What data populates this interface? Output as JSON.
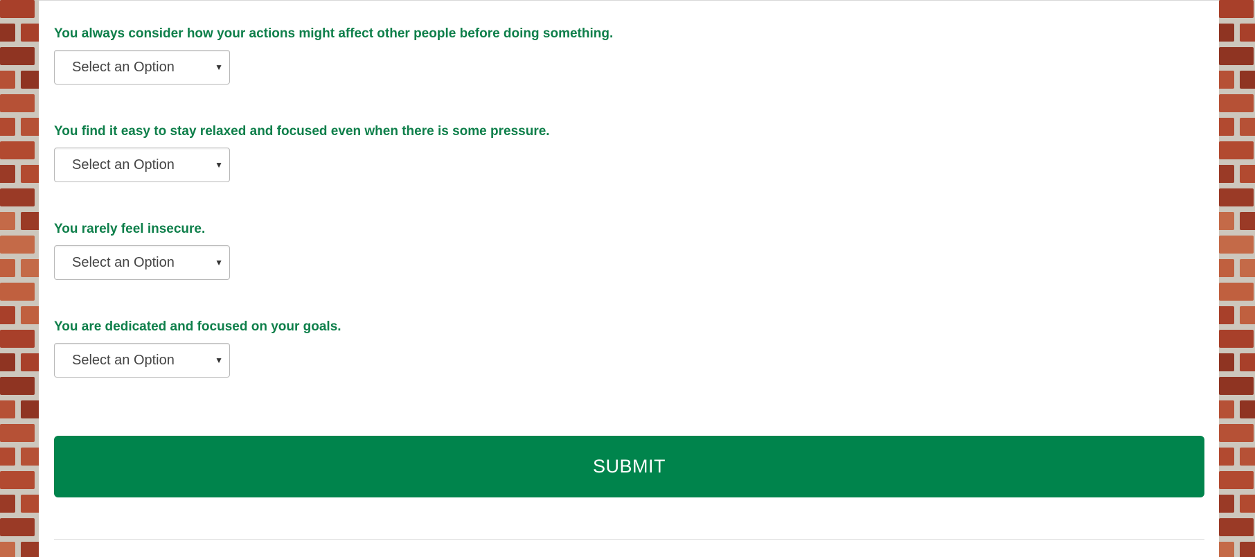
{
  "questions": [
    {
      "label": "You always consider how your actions might affect other people before doing something.",
      "select_value": "Select an Option"
    },
    {
      "label": "You find it easy to stay relaxed and focused even when there is some pressure.",
      "select_value": "Select an Option"
    },
    {
      "label": "You rarely feel insecure.",
      "select_value": "Select an Option"
    },
    {
      "label": "You are dedicated and focused on your goals.",
      "select_value": "Select an Option"
    }
  ],
  "select_icon": "chevron-down-icon",
  "submit": {
    "label": "SUBMIT"
  },
  "colors": {
    "question_text": "#0e7f4a",
    "submit_bg": "#00844c",
    "submit_text": "#ffffff",
    "panel_bg": "#ffffff"
  },
  "background": "brick-wall"
}
